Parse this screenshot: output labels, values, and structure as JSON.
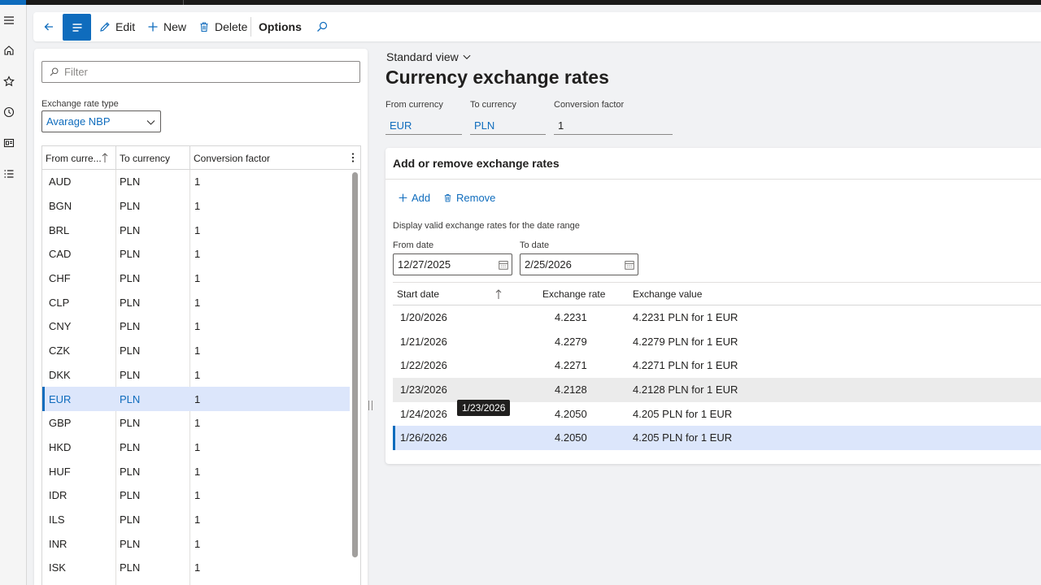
{
  "toolbar": {
    "edit_label": "Edit",
    "new_label": "New",
    "delete_label": "Delete",
    "options_label": "Options"
  },
  "list": {
    "filter_placeholder": "Filter",
    "rate_type_label": "Exchange rate type",
    "rate_type_value": "Avarage NBP",
    "columns": [
      "From curre...",
      "To currency",
      "Conversion factor"
    ],
    "rows": [
      {
        "from": "AUD",
        "to": "PLN",
        "factor": "1"
      },
      {
        "from": "BGN",
        "to": "PLN",
        "factor": "1"
      },
      {
        "from": "BRL",
        "to": "PLN",
        "factor": "1"
      },
      {
        "from": "CAD",
        "to": "PLN",
        "factor": "1"
      },
      {
        "from": "CHF",
        "to": "PLN",
        "factor": "1"
      },
      {
        "from": "CLP",
        "to": "PLN",
        "factor": "1"
      },
      {
        "from": "CNY",
        "to": "PLN",
        "factor": "1"
      },
      {
        "from": "CZK",
        "to": "PLN",
        "factor": "1"
      },
      {
        "from": "DKK",
        "to": "PLN",
        "factor": "1"
      },
      {
        "from": "EUR",
        "to": "PLN",
        "factor": "1"
      },
      {
        "from": "GBP",
        "to": "PLN",
        "factor": "1"
      },
      {
        "from": "HKD",
        "to": "PLN",
        "factor": "1"
      },
      {
        "from": "HUF",
        "to": "PLN",
        "factor": "1"
      },
      {
        "from": "IDR",
        "to": "PLN",
        "factor": "1"
      },
      {
        "from": "ILS",
        "to": "PLN",
        "factor": "1"
      },
      {
        "from": "INR",
        "to": "PLN",
        "factor": "1"
      },
      {
        "from": "ISK",
        "to": "PLN",
        "factor": "1"
      }
    ],
    "selected_index": 9
  },
  "detail": {
    "view_name": "Standard view",
    "title": "Currency exchange rates",
    "from_currency_label": "From currency",
    "from_currency_value": "EUR",
    "to_currency_label": "To currency",
    "to_currency_value": "PLN",
    "conversion_factor_label": "Conversion factor",
    "conversion_factor_value": "1"
  },
  "rates": {
    "section_title": "Add or remove exchange rates",
    "add_label": "Add",
    "remove_label": "Remove",
    "range_label": "Display valid exchange rates for the date range",
    "from_date_label": "From date",
    "from_date_value": "12/27/2025",
    "to_date_label": "To date",
    "to_date_value": "2/25/2026",
    "columns": [
      "Start date",
      "Exchange rate",
      "Exchange value"
    ],
    "rows": [
      {
        "date": "1/20/2026",
        "rate": "4.2231",
        "value": "4.2231 PLN for 1 EUR"
      },
      {
        "date": "1/21/2026",
        "rate": "4.2279",
        "value": "4.2279 PLN for 1 EUR"
      },
      {
        "date": "1/22/2026",
        "rate": "4.2271",
        "value": "4.2271 PLN for 1 EUR"
      },
      {
        "date": "1/23/2026",
        "rate": "4.2128",
        "value": "4.2128 PLN for 1 EUR"
      },
      {
        "date": "1/24/2026",
        "rate": "4.2050",
        "value": "4.205 PLN for 1 EUR"
      },
      {
        "date": "1/26/2026",
        "rate": "4.2050",
        "value": "4.205 PLN for 1 EUR"
      }
    ],
    "hover_index": 3,
    "selected_index": 5,
    "tooltip": "1/23/2026"
  },
  "colors": {
    "accent": "#0f6cbd",
    "selected_row": "#dce6fb",
    "hover_row": "#ebebeb"
  },
  "icons": {
    "rail": [
      "hamburger-icon",
      "home-icon",
      "star-icon",
      "clock-icon",
      "workspace-icon",
      "list-icon"
    ],
    "toolbar": [
      "back-arrow-icon",
      "list-view-icon",
      "pencil-icon",
      "plus-icon",
      "trash-icon",
      "search-icon"
    ]
  }
}
